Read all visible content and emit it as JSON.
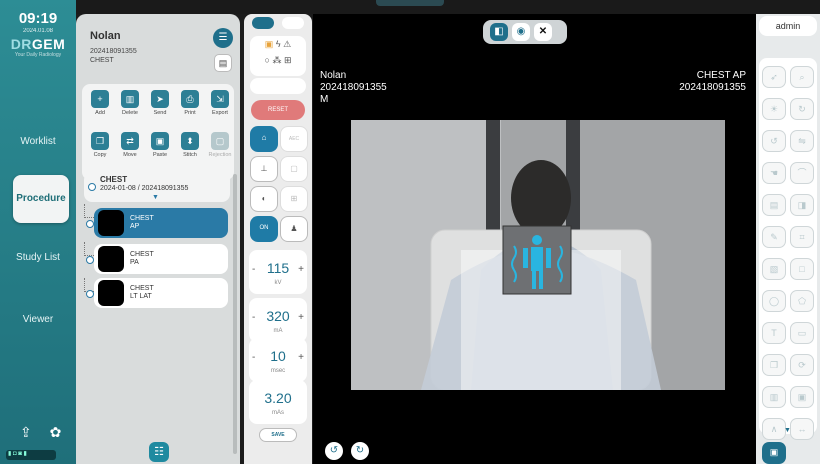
{
  "nav": {
    "time": "09:19",
    "date": "2024.01.08",
    "logo_a": "DR",
    "logo_b": "GEM",
    "tagline": "Your Daily Radiology",
    "items": [
      "Worklist",
      "Procedure",
      "Study List",
      "Viewer"
    ],
    "active_index": 1
  },
  "patient": {
    "name": "Nolan",
    "id": "202418091355",
    "body_part": "CHEST"
  },
  "tools": [
    {
      "label": "Add",
      "icon": "add-doc-icon"
    },
    {
      "label": "Delete",
      "icon": "trash-icon"
    },
    {
      "label": "Send",
      "icon": "send-icon"
    },
    {
      "label": "Print",
      "icon": "print-icon"
    },
    {
      "label": "Export",
      "icon": "export-icon"
    },
    {
      "label": "Copy",
      "icon": "copy-icon"
    },
    {
      "label": "Move",
      "icon": "move-icon"
    },
    {
      "label": "Paste",
      "icon": "paste-icon"
    },
    {
      "label": "Stitch",
      "icon": "stitch-icon"
    },
    {
      "label": "Rejection",
      "icon": "reject-icon"
    }
  ],
  "study": {
    "title": "CHEST",
    "subtitle": "2024-01-08 / 202418091355",
    "series": [
      {
        "line1": "CHEST",
        "line2": "AP"
      },
      {
        "line1": "CHEST",
        "line2": "PA"
      },
      {
        "line1": "CHEST",
        "line2": "LT LAT"
      }
    ],
    "selected_index": 0
  },
  "exposure": {
    "reset_label": "RESET",
    "kv": {
      "value": "115",
      "unit": "kV"
    },
    "ma": {
      "value": "320",
      "unit": "mA"
    },
    "msec": {
      "value": "10",
      "unit": "msec"
    },
    "mas": {
      "value": "3.20",
      "unit": "mAs"
    },
    "save_label": "SAVE",
    "on_label": "ON",
    "aec_label": "AEC",
    "minus": "-",
    "plus": "+"
  },
  "viewer": {
    "tl_name": "Nolan",
    "tl_id": "202418091355",
    "tl_sex": "M",
    "tr_view": "CHEST AP",
    "tr_id": "202418091355"
  },
  "user": "admin",
  "colors": {
    "accent": "#1f6f8b",
    "nav": "#2d8d95",
    "reset": "#e07a7a"
  }
}
